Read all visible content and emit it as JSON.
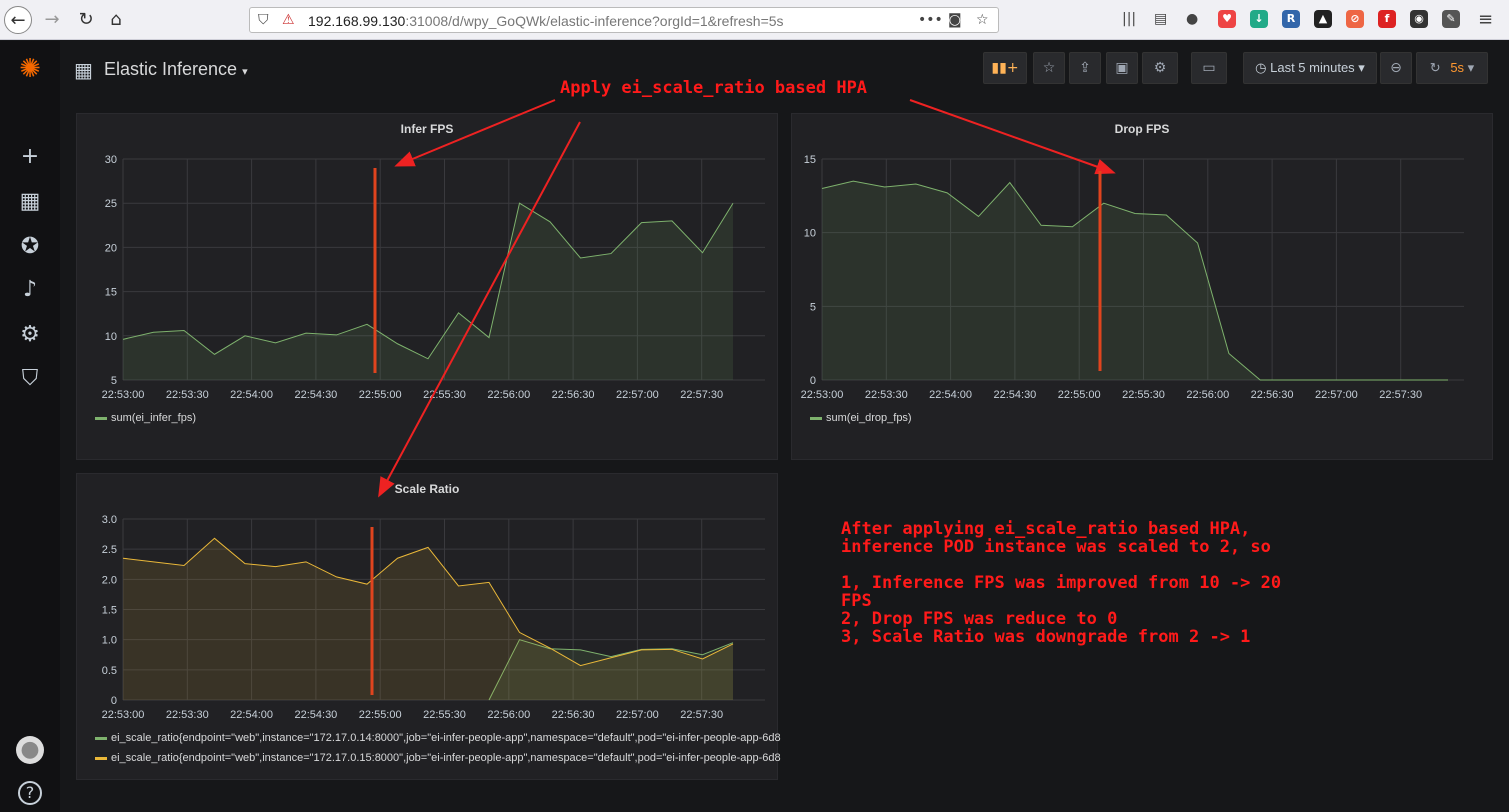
{
  "browser": {
    "url_host": "192.168.99.130",
    "url_rest": ":31008/d/wpy_GoQWk/elastic-inference?orgId=1&refresh=5s",
    "icons": [
      "back-icon",
      "forward-icon",
      "reload-icon",
      "home-icon",
      "shield-icon",
      "insecure-icon",
      "more-icon",
      "pocket-icon",
      "bookmark-star-icon",
      "library-icon",
      "reader-icon",
      "account-icon"
    ]
  },
  "dashboard": {
    "title": "Elastic Inference",
    "time_range_label": "Last 5 minutes",
    "refresh_label": "5s"
  },
  "annotations": {
    "top": "Apply ei_scale_ratio based HPA",
    "note_line1": "After applying ei_scale_ratio based HPA,",
    "note_line2": "inference POD instance was scaled to 2, so",
    "note_line3": "1, Inference FPS was improved from 10 -> 20",
    "note_line4": "FPS",
    "note_line5": "2, Drop FPS was reduce to 0",
    "note_line6": "3, Scale Ratio was downgrade from 2 -> 1",
    "color": "#ff1a1a"
  },
  "chart_data": [
    {
      "title": "Infer FPS",
      "type": "area",
      "x": [
        "22:53:00",
        "22:53:30",
        "22:54:00",
        "22:54:30",
        "22:55:00",
        "22:55:30",
        "22:56:00",
        "22:56:30",
        "22:57:00",
        "22:57:30"
      ],
      "ylim": [
        5,
        30
      ],
      "yticks": [
        "5",
        "10",
        "15",
        "20",
        "25",
        "30"
      ],
      "series": [
        {
          "name": "sum(ei_infer_fps)",
          "color": "#7eb26d",
          "values": [
            9.6,
            10.4,
            10.6,
            7.9,
            10.0,
            9.2,
            10.3,
            10.1,
            11.3,
            9.1,
            7.4,
            12.6,
            9.8,
            25.0,
            22.9,
            18.8,
            19.3,
            22.8,
            23.0,
            19.4,
            25.0
          ]
        }
      ]
    },
    {
      "title": "Drop FPS",
      "type": "area",
      "x": [
        "22:53:00",
        "22:53:30",
        "22:54:00",
        "22:54:30",
        "22:55:00",
        "22:55:30",
        "22:56:00",
        "22:56:30",
        "22:57:00",
        "22:57:30"
      ],
      "ylim": [
        0,
        15
      ],
      "yticks": [
        "0",
        "5",
        "10",
        "15"
      ],
      "series": [
        {
          "name": "sum(ei_drop_fps)",
          "color": "#7eb26d",
          "values": [
            13.0,
            13.5,
            13.1,
            13.3,
            12.7,
            11.1,
            13.4,
            10.5,
            10.4,
            12.0,
            11.3,
            11.2,
            9.3,
            1.8,
            0,
            0,
            0,
            0,
            0,
            0,
            0
          ]
        }
      ]
    },
    {
      "title": "Scale Ratio",
      "type": "area",
      "x": [
        "22:53:00",
        "22:53:30",
        "22:54:00",
        "22:54:30",
        "22:55:00",
        "22:55:30",
        "22:56:00",
        "22:56:30",
        "22:57:00",
        "22:57:30"
      ],
      "ylim": [
        0,
        3.0
      ],
      "yticks": [
        "0",
        "0.5",
        "1.0",
        "1.5",
        "2.0",
        "2.5",
        "3.0"
      ],
      "series": [
        {
          "name": "ei_scale_ratio{endpoint=\"web\",instance=\"172.17.0.14:8000\",job=\"ei-infer-people-app\",namespace=\"default\",pod=\"ei-infer-people-app-6d8",
          "color": "#7eb26d",
          "values": [
            null,
            null,
            null,
            null,
            null,
            null,
            null,
            null,
            null,
            null,
            null,
            null,
            0,
            1.0,
            0.85,
            0.83,
            0.72,
            0.84,
            0.85,
            0.75,
            0.95
          ]
        },
        {
          "name": "ei_scale_ratio{endpoint=\"web\",instance=\"172.17.0.15:8000\",job=\"ei-infer-people-app\",namespace=\"default\",pod=\"ei-infer-people-app-6d8",
          "color": "#eab839",
          "values": [
            2.35,
            2.29,
            2.23,
            2.68,
            2.26,
            2.21,
            2.29,
            2.04,
            1.92,
            2.35,
            2.53,
            1.89,
            1.95,
            1.12,
            0.86,
            0.57,
            0.7,
            0.83,
            0.84,
            0.68,
            0.93
          ]
        }
      ]
    }
  ]
}
